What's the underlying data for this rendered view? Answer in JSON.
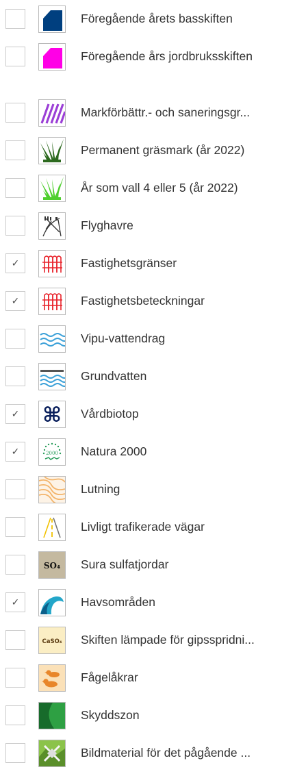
{
  "layers": [
    {
      "label": "Föregående årets basskiften",
      "checked": false,
      "icon": "dark-blue-parcel-icon",
      "check_mark": ""
    },
    {
      "label": "Föregående års jordbruksskiften",
      "checked": false,
      "icon": "magenta-parcel-icon",
      "check_mark": ""
    },
    {
      "label": "Markförbättr.- och saneringsgr...",
      "checked": false,
      "icon": "purple-hatch-icon",
      "check_mark": ""
    },
    {
      "label": "Permanent gräsmark (år 2022)",
      "checked": false,
      "icon": "dark-grass-icon",
      "check_mark": ""
    },
    {
      "label": "År som vall 4 eller 5 (år 2022)",
      "checked": false,
      "icon": "light-grass-icon",
      "check_mark": ""
    },
    {
      "label": "Flyghavre",
      "checked": false,
      "icon": "wild-oat-icon",
      "check_mark": ""
    },
    {
      "label": "Fastighetsgränser",
      "checked": true,
      "icon": "red-fence-icon",
      "check_mark": "✓"
    },
    {
      "label": "Fastighetsbeteckningar",
      "checked": true,
      "icon": "red-fence-icon",
      "check_mark": "✓"
    },
    {
      "label": "Vipu-vattendrag",
      "checked": false,
      "icon": "water-waves-icon",
      "check_mark": ""
    },
    {
      "label": "Grundvatten",
      "checked": false,
      "icon": "groundwater-icon",
      "check_mark": ""
    },
    {
      "label": "Vårdbiotop",
      "checked": true,
      "icon": "biotope-symbol-icon",
      "check_mark": "✓"
    },
    {
      "label": "Natura 2000",
      "checked": true,
      "icon": "natura-2000-icon",
      "check_mark": "✓"
    },
    {
      "label": "Lutning",
      "checked": false,
      "icon": "slope-contour-icon",
      "check_mark": ""
    },
    {
      "label": "Livligt trafikerade vägar",
      "checked": false,
      "icon": "road-icon",
      "check_mark": ""
    },
    {
      "label": "Sura sulfatjordar",
      "checked": false,
      "icon": "so4-icon",
      "check_mark": ""
    },
    {
      "label": "Havsområden",
      "checked": true,
      "icon": "sea-wave-icon",
      "check_mark": "✓"
    },
    {
      "label": "Skiften lämpade för gipsspridni...",
      "checked": false,
      "icon": "caso4-icon",
      "check_mark": ""
    },
    {
      "label": "Fågelåkrar",
      "checked": false,
      "icon": "birds-icon",
      "check_mark": ""
    },
    {
      "label": "Skyddszon",
      "checked": false,
      "icon": "buffer-zone-icon",
      "check_mark": ""
    },
    {
      "label": "Bildmaterial för det pågående ...",
      "checked": false,
      "icon": "image-material-icon",
      "check_mark": ""
    }
  ],
  "icon_text": {
    "natura": "2000",
    "so4": "SO₄",
    "caso4": "CaSO₄"
  },
  "colors": {
    "dark_blue": "#003f7f",
    "magenta": "#ff00e6",
    "purple": "#9b3fd6",
    "red": "#e8232b",
    "water": "#3aa0d8",
    "navy": "#0a1f5c",
    "natura_green": "#2a9d5c"
  }
}
